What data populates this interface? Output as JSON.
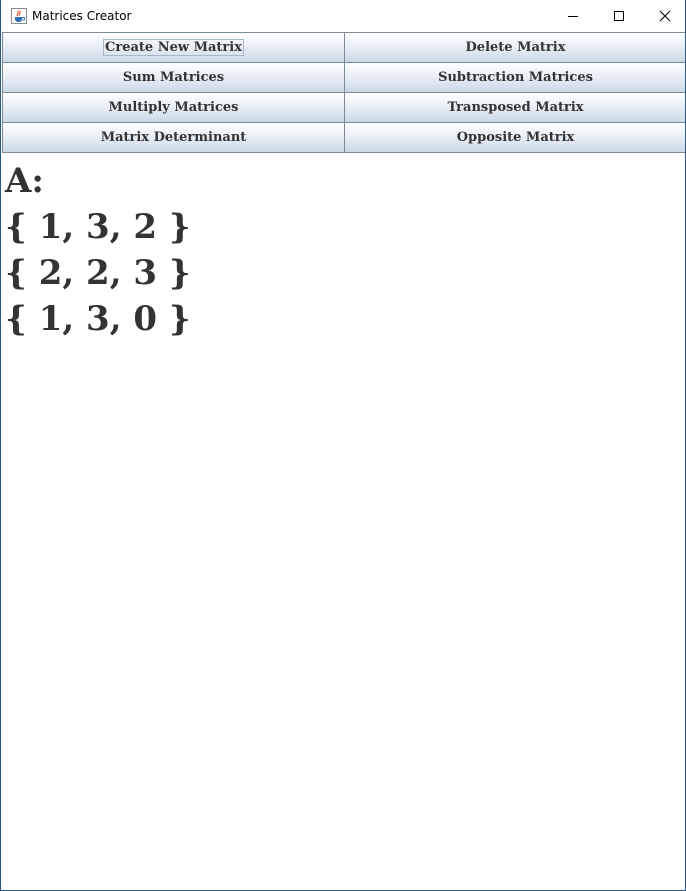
{
  "window": {
    "title": "Matrices Creator",
    "icon": "java-cup-icon",
    "controls": {
      "minimize_icon": "minimize-icon",
      "maximize_icon": "maximize-icon",
      "close_icon": "close-icon"
    }
  },
  "buttons": {
    "create_new_matrix": "Create New Matrix",
    "delete_matrix": "Delete Matrix",
    "sum_matrices": "Sum Matrices",
    "subtraction_matrices": "Subtraction Matrices",
    "multiply_matrices": "Multiply Matrices",
    "transposed_matrix": "Transposed Matrix",
    "matrix_determinant": "Matrix Determinant",
    "opposite_matrix": "Opposite Matrix"
  },
  "matrix_display": {
    "name_line": "A:",
    "rows": [
      "{ 1, 3, 2 }",
      "{ 2, 2, 3 }",
      "{ 1, 3, 0 }"
    ]
  },
  "colors": {
    "window_border": "#2a5b86",
    "button_border": "#7a8a99",
    "text": "#333333"
  }
}
